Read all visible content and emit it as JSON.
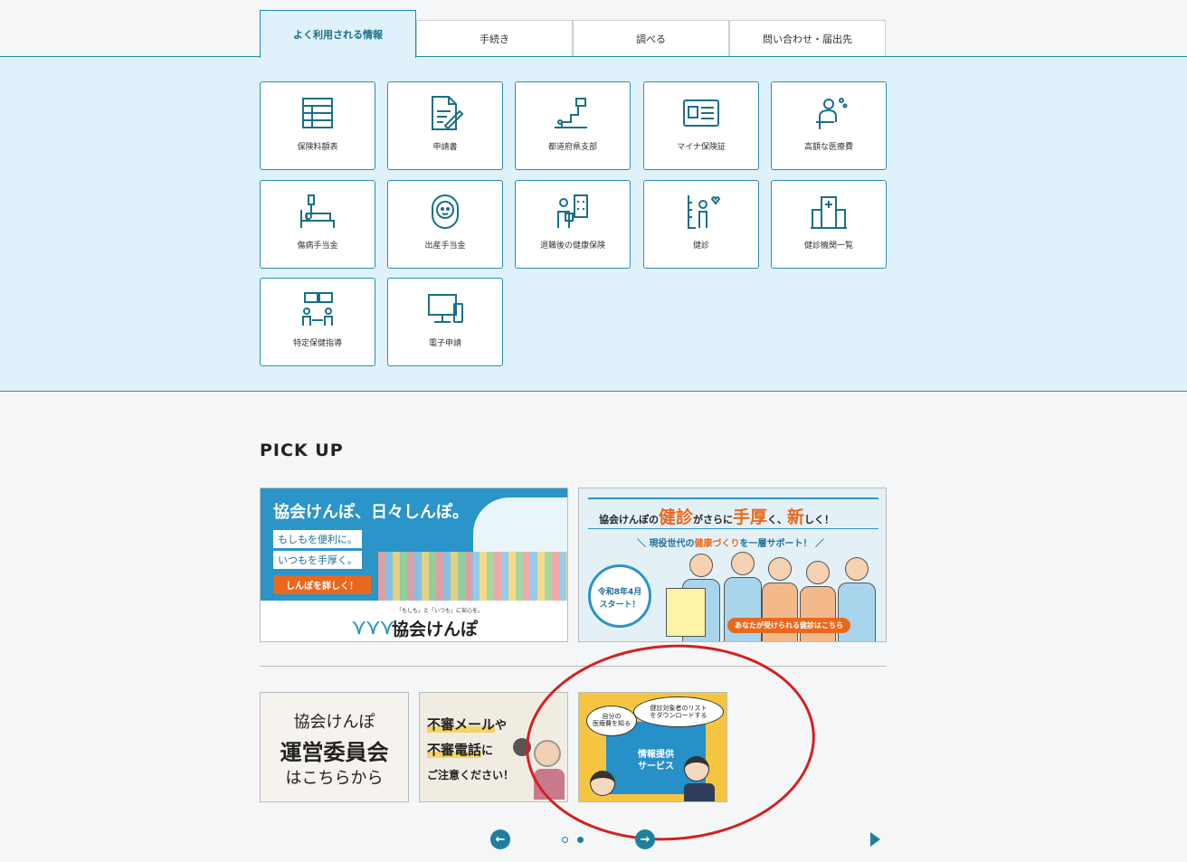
{
  "tabs": [
    {
      "label": "よく利用される情報",
      "active": true
    },
    {
      "label": "手続き",
      "active": false
    },
    {
      "label": "調べる",
      "active": false
    },
    {
      "label": "問い合わせ・届出先",
      "active": false
    }
  ],
  "cards": [
    {
      "label": "保険料額表",
      "icon": "table-icon"
    },
    {
      "label": "申請書",
      "icon": "document-pen-icon"
    },
    {
      "label": "都道府県支部",
      "icon": "location-icon"
    },
    {
      "label": "マイナ保険証",
      "icon": "id-card-icon"
    },
    {
      "label": "高額な医療費",
      "icon": "worried-person-icon"
    },
    {
      "label": "傷病手当金",
      "icon": "hospital-bed-icon"
    },
    {
      "label": "出産手当金",
      "icon": "baby-icon"
    },
    {
      "label": "退職後の健康保険",
      "icon": "retire-building-icon"
    },
    {
      "label": "健診",
      "icon": "height-check-icon"
    },
    {
      "label": "健診機関一覧",
      "icon": "hospital-icon"
    },
    {
      "label": "特定保健指導",
      "icon": "consultation-icon"
    },
    {
      "label": "電子申請",
      "icon": "computer-icon"
    }
  ],
  "pickup": {
    "title": "PICK UP",
    "banner1": {
      "headline": "協会けんぽ、日々しんぽ。",
      "line1": "もしもを便利に。",
      "line2": "いつもを手厚く。",
      "cta": "しんぽを詳しく！",
      "tagline": "「もしも」と「いつも」に安心を。",
      "logo": "協会けんぽ"
    },
    "banner2": {
      "headline_pre": "協会けんぽの",
      "headline_a": "健診",
      "headline_mid": "がさらに",
      "headline_b": "手厚",
      "headline_mid2": "く、",
      "headline_c": "新",
      "headline_end": "しく！",
      "sub_pre": "現役世代の",
      "sub_em": "健康づくり",
      "sub_end": "を一層サポート！",
      "date": "令和8年4月",
      "start": "スタート！",
      "cta": "あなたが受けられる健診はこちら"
    },
    "small1": {
      "line1": "協会けんぽ",
      "line2": "運営委員会",
      "line3": "はこちらから"
    },
    "small2": {
      "line1a": "不審メール",
      "line1b": "や",
      "line2a": "不審電話",
      "line2b": "に",
      "line3": "ご注意ください！"
    },
    "small3": {
      "bubble1": "自分の\n医療費を知る",
      "bubble2": "健診対象者のリスト\nをダウンロードする",
      "screen": "情報提供\nサービス"
    }
  },
  "carousel": {
    "prev": "←",
    "next": "→",
    "dots": [
      false,
      true
    ]
  },
  "colors": {
    "accent": "#1f8cab",
    "panel": "#dff1fa",
    "orange": "#e8691e",
    "annotation": "#d42020"
  }
}
